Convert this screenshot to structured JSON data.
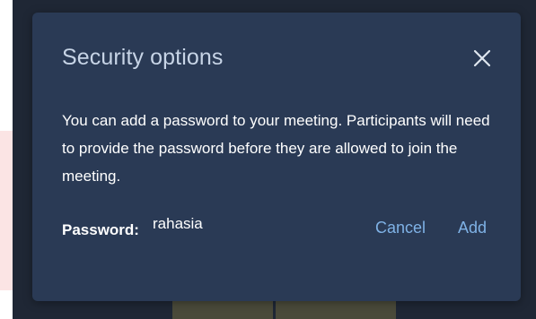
{
  "dialog": {
    "title": "Security options",
    "close_icon": "close-icon",
    "message": "You can add a password to your meeting. Participants will need to provide the password before they are allowed to join the meeting.",
    "password_label": "Password:",
    "password_value": "rahasia",
    "cancel_label": "Cancel",
    "add_label": "Add"
  },
  "colors": {
    "dialog_background": "#2a3a55",
    "backdrop": "#1f2735",
    "title_text": "#c7d4e6",
    "body_text": "#ffffff",
    "action_text": "#7fb2e6"
  }
}
